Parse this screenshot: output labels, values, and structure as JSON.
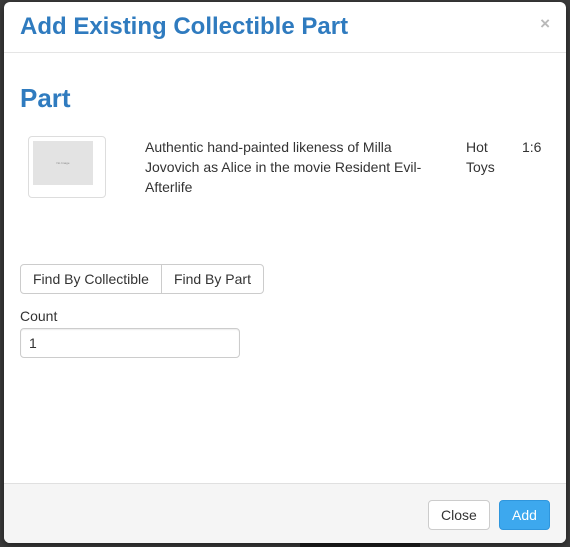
{
  "modal": {
    "title": "Add Existing Collectible Part",
    "close_symbol": "×"
  },
  "part": {
    "heading": "Part",
    "image_caption": "No Image",
    "description": "Authentic hand-painted likeness of Milla Jovovich as Alice in the movie Resident Evil-Afterlife",
    "manufacturer": "Hot Toys",
    "scale": "1:6"
  },
  "find_buttons": {
    "by_collectible": "Find By Collectible",
    "by_part": "Find By Part"
  },
  "count": {
    "label": "Count",
    "value": "1"
  },
  "footer": {
    "close_label": "Close",
    "add_label": "Add"
  },
  "colors": {
    "title": "#2f7bbf",
    "add_button": "#3da8ee",
    "backdrop": "#3b3b3b"
  }
}
